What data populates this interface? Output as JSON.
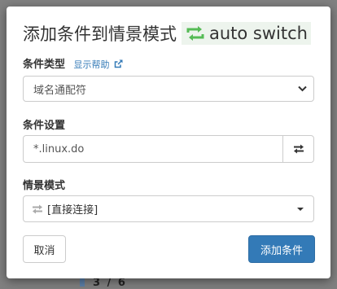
{
  "dialog": {
    "title": "添加条件到情景模式",
    "profile_name": "auto switch",
    "profile_color": "#55bb55"
  },
  "condition_type": {
    "label": "条件类型",
    "help_link": "显示帮助",
    "selected": "域名通配符"
  },
  "condition_details": {
    "label": "条件设置",
    "value": "*.linux.do"
  },
  "result_profile": {
    "label": "情景模式",
    "selected": "[直接连接]"
  },
  "buttons": {
    "cancel": "取消",
    "add": "添加条件"
  },
  "background": {
    "visible_fragment": "3 / 6",
    "accent_color": "#5b7fa8"
  }
}
